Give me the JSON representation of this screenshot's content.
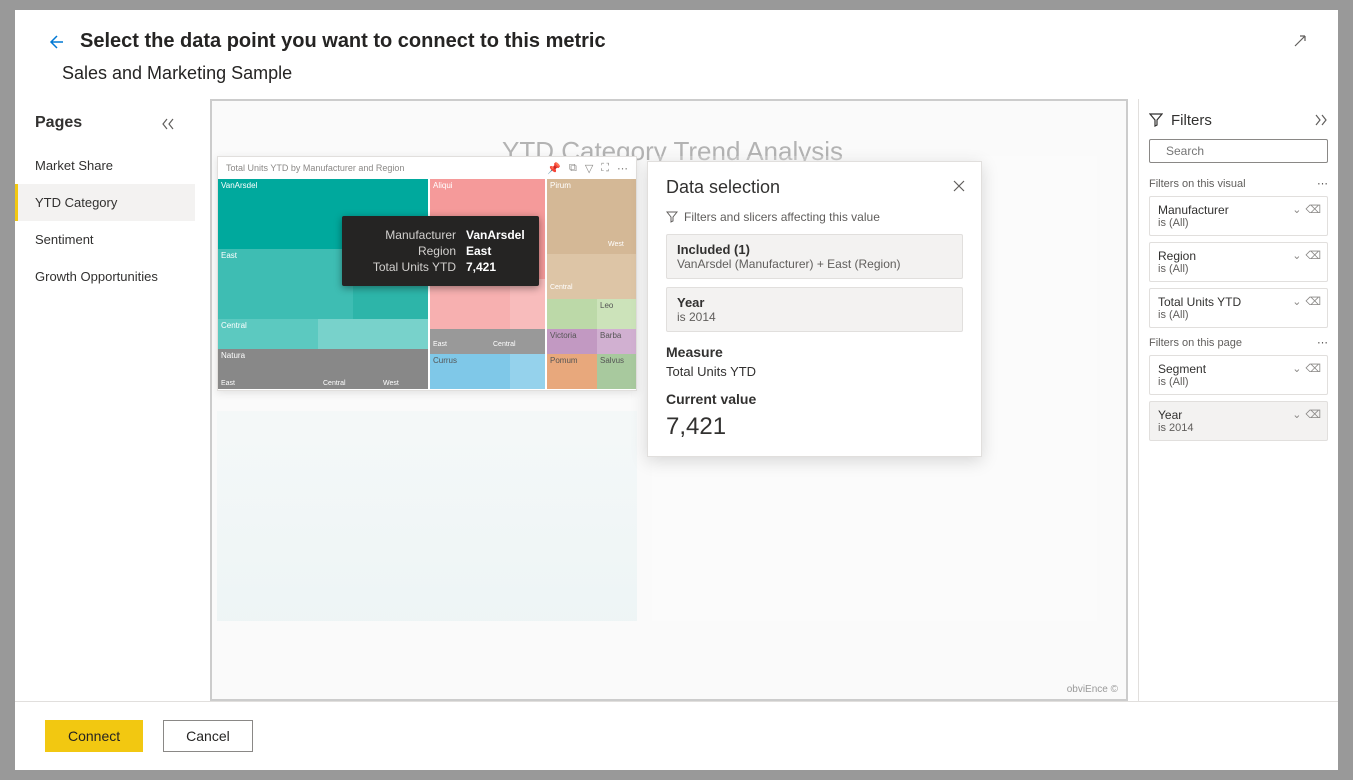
{
  "header": {
    "title": "Select the data point you want to connect to this metric",
    "subtitle": "Sales and Marketing Sample"
  },
  "pages": {
    "title": "Pages",
    "items": [
      "Market Share",
      "YTD Category",
      "Sentiment",
      "Growth Opportunities"
    ],
    "active_index": 1
  },
  "report": {
    "title": "YTD Category Trend Analysis",
    "treemap_title": "Total Units YTD by Manufacturer and Region",
    "obvience": "obviEnce ©"
  },
  "tooltip": {
    "rows": [
      {
        "label": "Manufacturer",
        "value": "VanArsdel"
      },
      {
        "label": "Region",
        "value": "East"
      },
      {
        "label": "Total Units YTD",
        "value": "7,421"
      }
    ]
  },
  "treemap": {
    "blocks": [
      {
        "name": "VanArsdel",
        "sub": "East"
      },
      {
        "name": "Aliqui"
      },
      {
        "name": "Pirum"
      },
      {
        "name": "Natura"
      },
      {
        "name": "Currus"
      },
      {
        "name": "Victoria"
      },
      {
        "name": "Pomum"
      },
      {
        "name": "Barba"
      },
      {
        "name": "Leo"
      },
      {
        "name": "Salvus"
      }
    ],
    "regions": [
      "East",
      "West",
      "Central"
    ]
  },
  "data_panel": {
    "title": "Data selection",
    "filters_label": "Filters and slicers affecting this value",
    "included": {
      "title": "Included (1)",
      "sub": "VanArsdel (Manufacturer) + East (Region)"
    },
    "year": {
      "title": "Year",
      "sub": "is 2014"
    },
    "measure_label": "Measure",
    "measure_value": "Total Units YTD",
    "current_label": "Current value",
    "current_value": "7,421"
  },
  "filters": {
    "title": "Filters",
    "search_placeholder": "Search",
    "visual_label": "Filters on this visual",
    "page_label": "Filters on this page",
    "visual_cards": [
      {
        "name": "Manufacturer",
        "value": "is (All)"
      },
      {
        "name": "Region",
        "value": "is (All)"
      },
      {
        "name": "Total Units YTD",
        "value": "is (All)"
      }
    ],
    "page_cards": [
      {
        "name": "Segment",
        "value": "is (All)"
      },
      {
        "name": "Year",
        "value": "is 2014",
        "active": true
      }
    ]
  },
  "footer": {
    "connect": "Connect",
    "cancel": "Cancel"
  }
}
